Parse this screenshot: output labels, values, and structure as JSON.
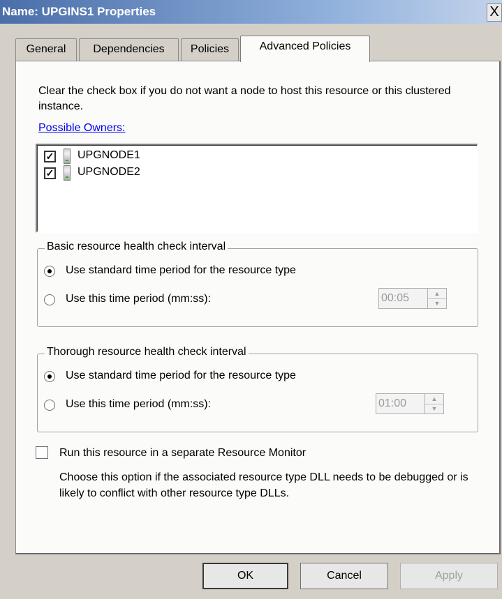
{
  "window": {
    "title": "Name: UPGINS1 Properties",
    "close_label": "X"
  },
  "tabs": [
    {
      "label": "General",
      "active": false
    },
    {
      "label": "Dependencies",
      "active": false
    },
    {
      "label": "Policies",
      "active": false
    },
    {
      "label": "Advanced Policies",
      "active": true
    }
  ],
  "panel": {
    "instructions": "Clear the check box if you do not want a node to host this resource or this clustered instance.",
    "possible_owners_label": "Possible Owners:",
    "owners": [
      {
        "name": "UPGNODE1",
        "checked": true,
        "icon": "server-icon"
      },
      {
        "name": "UPGNODE2",
        "checked": true,
        "icon": "server-icon"
      }
    ],
    "basic_check": {
      "legend": "Basic resource health check interval",
      "option_standard": "Use standard time period for the resource type",
      "option_custom": "Use this time period (mm:ss):",
      "selected": "standard",
      "time_value": "00:05"
    },
    "thorough_check": {
      "legend": "Thorough resource health check interval",
      "option_standard": "Use standard time period for the resource type",
      "option_custom": "Use this time period (mm:ss):",
      "selected": "standard",
      "time_value": "01:00"
    },
    "separate_monitor": {
      "label": "Run this resource in a separate Resource Monitor",
      "checked": false,
      "description": "Choose this option if the associated resource type DLL needs to be debugged or is likely to conflict with other resource type DLLs."
    }
  },
  "buttons": {
    "ok": "OK",
    "cancel": "Cancel",
    "apply": "Apply"
  },
  "colors": {
    "title_bar": "#4a6ea9",
    "dialog_bg": "#d4d0c8",
    "panel_bg": "#fbfbfa",
    "link": "#0000ee"
  }
}
